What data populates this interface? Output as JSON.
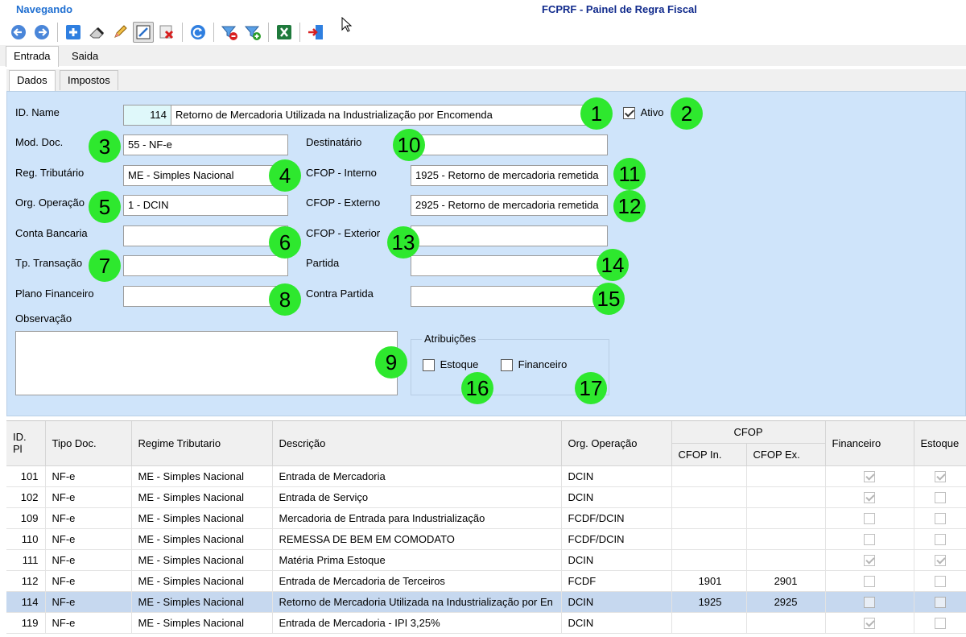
{
  "header": {
    "status": "Navegando",
    "title": "FCPRF - Painel de Regra Fiscal"
  },
  "toolbar": {
    "buttons": [
      "arrow-left-icon",
      "arrow-right-icon",
      "add-icon",
      "eraser-icon",
      "edit-icon",
      "edit-form-icon",
      "delete-icon",
      "refresh-icon",
      "filter-remove-icon",
      "filter-add-icon",
      "excel-icon",
      "exit-icon"
    ]
  },
  "tabs_main": [
    "Entrada",
    "Saida"
  ],
  "tabs_sub": [
    "Dados",
    "Impostos"
  ],
  "form": {
    "id_name_label": "ID. Name",
    "id_value": "114",
    "name_value": "Retorno de Mercadoria Utilizada na Industrialização por Encomenda",
    "ativo_label": "Ativo",
    "mod_doc_label": "Mod. Doc.",
    "mod_doc_value": "55 - NF-e",
    "reg_trib_label": "Reg. Tributário",
    "reg_trib_value": "ME - Simples Nacional",
    "org_op_label": "Org. Operação",
    "org_op_value": "1 - DCIN",
    "conta_label": "Conta Bancaria",
    "tp_trans_label": "Tp. Transação",
    "plano_label": "Plano Financeiro",
    "obs_label": "Observação",
    "dest_label": "Destinatário",
    "cfop_int_label": "CFOP - Interno",
    "cfop_int_value": "1925 - Retorno de mercadoria remetida",
    "cfop_ext_label": "CFOP - Externo",
    "cfop_ext_value": "2925 - Retorno de mercadoria remetida",
    "cfop_exterior_label": "CFOP - Exterior",
    "partida_label": "Partida",
    "contra_label": "Contra Partida",
    "atrib_label": "Atribuições",
    "estoque_label": "Estoque",
    "financeiro_label": "Financeiro"
  },
  "badges": [
    "1",
    "2",
    "3",
    "4",
    "5",
    "6",
    "7",
    "8",
    "9",
    "10",
    "11",
    "12",
    "13",
    "14",
    "15",
    "16",
    "17"
  ],
  "grid": {
    "headers": {
      "id": "ID. Pl",
      "tipo": "Tipo Doc.",
      "regime": "Regime Tributario",
      "descricao": "Descrição",
      "org": "Org. Operação",
      "cfop": "CFOP",
      "cfop_in": "CFOP In.",
      "cfop_ex": "CFOP Ex.",
      "financeiro": "Financeiro",
      "estoque": "Estoque"
    },
    "rows": [
      {
        "id": "101",
        "tipo": "NF-e",
        "regime": "ME - Simples Nacional",
        "descricao": "Entrada de Mercadoria",
        "org": "DCIN",
        "cfop_in": "",
        "cfop_ex": "",
        "financeiro": true,
        "estoque": true
      },
      {
        "id": "102",
        "tipo": "NF-e",
        "regime": "ME - Simples Nacional",
        "descricao": "Entrada de Serviço",
        "org": "DCIN",
        "cfop_in": "",
        "cfop_ex": "",
        "financeiro": true,
        "estoque": false
      },
      {
        "id": "109",
        "tipo": "NF-e",
        "regime": "ME - Simples Nacional",
        "descricao": "Mercadoria de Entrada para Industrialização",
        "org": "FCDF/DCIN",
        "cfop_in": "",
        "cfop_ex": "",
        "financeiro": false,
        "estoque": false
      },
      {
        "id": "110",
        "tipo": "NF-e",
        "regime": "ME - Simples Nacional",
        "descricao": "REMESSA DE BEM EM COMODATO",
        "org": "FCDF/DCIN",
        "cfop_in": "",
        "cfop_ex": "",
        "financeiro": false,
        "estoque": false
      },
      {
        "id": "111",
        "tipo": "NF-e",
        "regime": "ME - Simples Nacional",
        "descricao": "Matéria Prima Estoque",
        "org": "DCIN",
        "cfop_in": "",
        "cfop_ex": "",
        "financeiro": true,
        "estoque": true
      },
      {
        "id": "112",
        "tipo": "NF-e",
        "regime": "ME - Simples Nacional",
        "descricao": "Entrada de Mercadoria de Terceiros",
        "org": "FCDF",
        "cfop_in": "1901",
        "cfop_ex": "2901",
        "financeiro": false,
        "estoque": false
      },
      {
        "id": "114",
        "tipo": "NF-e",
        "regime": "ME - Simples Nacional",
        "descricao": "Retorno de Mercadoria Utilizada na Industrialização por En",
        "org": "DCIN",
        "cfop_in": "1925",
        "cfop_ex": "2925",
        "financeiro": false,
        "estoque": false,
        "selected": true
      },
      {
        "id": "119",
        "tipo": "NF-e",
        "regime": "ME - Simples Nacional",
        "descricao": "Entrada de Mercadoria - IPI 3,25%",
        "org": "DCIN",
        "cfop_in": "",
        "cfop_ex": "",
        "financeiro": true,
        "estoque": false
      }
    ]
  }
}
